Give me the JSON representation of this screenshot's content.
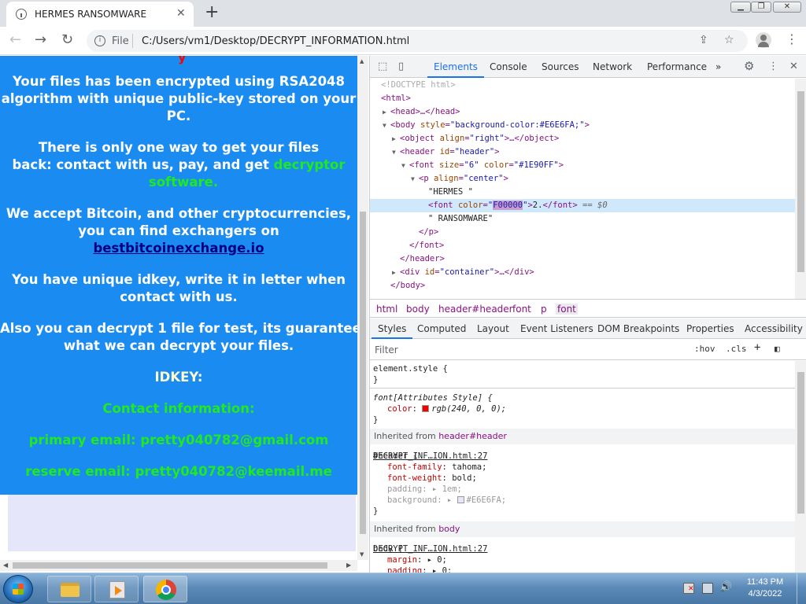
{
  "browser": {
    "tab_title": "HERMES RANSOMWARE",
    "tab_close": "✕",
    "new_tab": "+",
    "scheme_label": "File",
    "url": "C:/Users/vm1/Desktop/DECRYPT_INFORMATION.html",
    "window_buttons": {
      "minimize": "▁",
      "maximize": "❐",
      "close": "✕"
    }
  },
  "page": {
    "line1": "Your files has been encrypted using RSA2048",
    "line2": "algorithm with unique public-key stored on your",
    "line3": "PC.",
    "line4": "There is  only one way   to get your files",
    "line5a": "back:  contact with us,  pay,  and get ",
    "line5b": "decryptor",
    "line6": "software.",
    "line7": "We accept Bitcoin, and other cryptocurrencies,",
    "line8": "you can find exchangers on",
    "link": "bestbitcoinexchange.io",
    "line9": "You have unique idkey, write it in letter when",
    "line10": "contact with us.",
    "line11": "Also you can decrypt 1 file for test, its guarantee",
    "line12": "what we can decrypt your files.",
    "idkey": "IDKEY:",
    "contact": "Contact information:",
    "primary": "primary email: pretty040782@gmail.com",
    "reserve": "reserve email: pretty040782@keemail.me"
  },
  "devtools": {
    "tabs": [
      "Elements",
      "Console",
      "Sources",
      "Network",
      "Performance"
    ],
    "more": "»",
    "elements": {
      "doctype": "<!DOCTYPE html>",
      "html": "<html>",
      "head": "<head>…</head>",
      "body_open": "<body",
      "body_attr": "style",
      "body_val": "\"background-color:#E6E6FA;\"",
      "object_attr": "align",
      "object_val": "\"right\"",
      "header_attr": "id",
      "header_val": "\"header\"",
      "font_size_attr": "size",
      "font_size_val": "\"6\"",
      "font_color_attr": "color",
      "font_color_val": "\"#1E90FF\"",
      "p_attr": "align",
      "p_val": "\"center\"",
      "text_hermes": "\"HERMES \"",
      "sel_color_val": "F00000",
      "sel_text": "2.",
      "sel_eq": "== $0",
      "text_ransom": "\" RANSOMWARE\"",
      "p_close": "</p>",
      "font_close": "</font>",
      "header_close": "</header>",
      "div_attr": "id",
      "div_val": "\"container\"",
      "body_close": "</body>"
    },
    "breadcrumbs": [
      "html",
      "body",
      "header#header",
      "font",
      "p",
      "font"
    ],
    "style_tabs": [
      "Styles",
      "Computed",
      "Layout",
      "Event Listeners",
      "DOM Breakpoints",
      "Properties",
      "Accessibility"
    ],
    "filter_placeholder": "Filter",
    "hov": ":hov",
    "cls": ".cls",
    "plus": "+",
    "styles": {
      "element_style": "element.style {",
      "close": "}",
      "font_attr_sel": "font[Attributes Style] {",
      "color_prop": "color",
      "color_val": "rgb(240, 0, 0);",
      "color_swatch": "#f00000",
      "inherited_label": "Inherited from ",
      "inherited_header": "header#header",
      "header_sel": "#header {",
      "header_src": "DECRYPT_INF…ION.html:27",
      "ff_prop": "font-family",
      "ff_val": "tahoma;",
      "fw_prop": "font-weight",
      "fw_val": "bold;",
      "pad_prop": "padding",
      "pad_val": "1em;",
      "bg_prop": "background",
      "bg_val": "#E6E6FA;",
      "bg_swatch": "#E6E6FA",
      "inherited_body": "body",
      "body_sel": "body {",
      "body_src": "DECRYPT_INF…ION.html:27",
      "margin_prop": "margin",
      "margin_val": "0;",
      "padding_prop": "padding",
      "padding_val": "0;"
    }
  },
  "taskbar": {
    "time": "11:43 PM",
    "date": "4/3/2022"
  },
  "colors": {
    "page_blue": "#1a8bf0",
    "page_green": "#1fe91f",
    "devtools_accent": "#1a73e8"
  }
}
